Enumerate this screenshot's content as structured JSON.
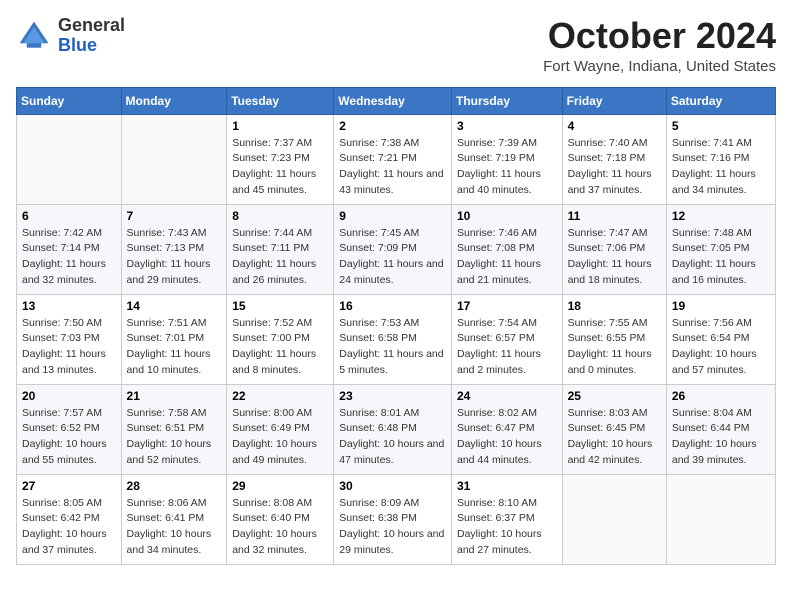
{
  "header": {
    "logo_general": "General",
    "logo_blue": "Blue",
    "month": "October 2024",
    "location": "Fort Wayne, Indiana, United States"
  },
  "weekdays": [
    "Sunday",
    "Monday",
    "Tuesday",
    "Wednesday",
    "Thursday",
    "Friday",
    "Saturday"
  ],
  "weeks": [
    [
      {
        "day": "",
        "info": ""
      },
      {
        "day": "",
        "info": ""
      },
      {
        "day": "1",
        "info": "Sunrise: 7:37 AM\nSunset: 7:23 PM\nDaylight: 11 hours and 45 minutes."
      },
      {
        "day": "2",
        "info": "Sunrise: 7:38 AM\nSunset: 7:21 PM\nDaylight: 11 hours and 43 minutes."
      },
      {
        "day": "3",
        "info": "Sunrise: 7:39 AM\nSunset: 7:19 PM\nDaylight: 11 hours and 40 minutes."
      },
      {
        "day": "4",
        "info": "Sunrise: 7:40 AM\nSunset: 7:18 PM\nDaylight: 11 hours and 37 minutes."
      },
      {
        "day": "5",
        "info": "Sunrise: 7:41 AM\nSunset: 7:16 PM\nDaylight: 11 hours and 34 minutes."
      }
    ],
    [
      {
        "day": "6",
        "info": "Sunrise: 7:42 AM\nSunset: 7:14 PM\nDaylight: 11 hours and 32 minutes."
      },
      {
        "day": "7",
        "info": "Sunrise: 7:43 AM\nSunset: 7:13 PM\nDaylight: 11 hours and 29 minutes."
      },
      {
        "day": "8",
        "info": "Sunrise: 7:44 AM\nSunset: 7:11 PM\nDaylight: 11 hours and 26 minutes."
      },
      {
        "day": "9",
        "info": "Sunrise: 7:45 AM\nSunset: 7:09 PM\nDaylight: 11 hours and 24 minutes."
      },
      {
        "day": "10",
        "info": "Sunrise: 7:46 AM\nSunset: 7:08 PM\nDaylight: 11 hours and 21 minutes."
      },
      {
        "day": "11",
        "info": "Sunrise: 7:47 AM\nSunset: 7:06 PM\nDaylight: 11 hours and 18 minutes."
      },
      {
        "day": "12",
        "info": "Sunrise: 7:48 AM\nSunset: 7:05 PM\nDaylight: 11 hours and 16 minutes."
      }
    ],
    [
      {
        "day": "13",
        "info": "Sunrise: 7:50 AM\nSunset: 7:03 PM\nDaylight: 11 hours and 13 minutes."
      },
      {
        "day": "14",
        "info": "Sunrise: 7:51 AM\nSunset: 7:01 PM\nDaylight: 11 hours and 10 minutes."
      },
      {
        "day": "15",
        "info": "Sunrise: 7:52 AM\nSunset: 7:00 PM\nDaylight: 11 hours and 8 minutes."
      },
      {
        "day": "16",
        "info": "Sunrise: 7:53 AM\nSunset: 6:58 PM\nDaylight: 11 hours and 5 minutes."
      },
      {
        "day": "17",
        "info": "Sunrise: 7:54 AM\nSunset: 6:57 PM\nDaylight: 11 hours and 2 minutes."
      },
      {
        "day": "18",
        "info": "Sunrise: 7:55 AM\nSunset: 6:55 PM\nDaylight: 11 hours and 0 minutes."
      },
      {
        "day": "19",
        "info": "Sunrise: 7:56 AM\nSunset: 6:54 PM\nDaylight: 10 hours and 57 minutes."
      }
    ],
    [
      {
        "day": "20",
        "info": "Sunrise: 7:57 AM\nSunset: 6:52 PM\nDaylight: 10 hours and 55 minutes."
      },
      {
        "day": "21",
        "info": "Sunrise: 7:58 AM\nSunset: 6:51 PM\nDaylight: 10 hours and 52 minutes."
      },
      {
        "day": "22",
        "info": "Sunrise: 8:00 AM\nSunset: 6:49 PM\nDaylight: 10 hours and 49 minutes."
      },
      {
        "day": "23",
        "info": "Sunrise: 8:01 AM\nSunset: 6:48 PM\nDaylight: 10 hours and 47 minutes."
      },
      {
        "day": "24",
        "info": "Sunrise: 8:02 AM\nSunset: 6:47 PM\nDaylight: 10 hours and 44 minutes."
      },
      {
        "day": "25",
        "info": "Sunrise: 8:03 AM\nSunset: 6:45 PM\nDaylight: 10 hours and 42 minutes."
      },
      {
        "day": "26",
        "info": "Sunrise: 8:04 AM\nSunset: 6:44 PM\nDaylight: 10 hours and 39 minutes."
      }
    ],
    [
      {
        "day": "27",
        "info": "Sunrise: 8:05 AM\nSunset: 6:42 PM\nDaylight: 10 hours and 37 minutes."
      },
      {
        "day": "28",
        "info": "Sunrise: 8:06 AM\nSunset: 6:41 PM\nDaylight: 10 hours and 34 minutes."
      },
      {
        "day": "29",
        "info": "Sunrise: 8:08 AM\nSunset: 6:40 PM\nDaylight: 10 hours and 32 minutes."
      },
      {
        "day": "30",
        "info": "Sunrise: 8:09 AM\nSunset: 6:38 PM\nDaylight: 10 hours and 29 minutes."
      },
      {
        "day": "31",
        "info": "Sunrise: 8:10 AM\nSunset: 6:37 PM\nDaylight: 10 hours and 27 minutes."
      },
      {
        "day": "",
        "info": ""
      },
      {
        "day": "",
        "info": ""
      }
    ]
  ]
}
